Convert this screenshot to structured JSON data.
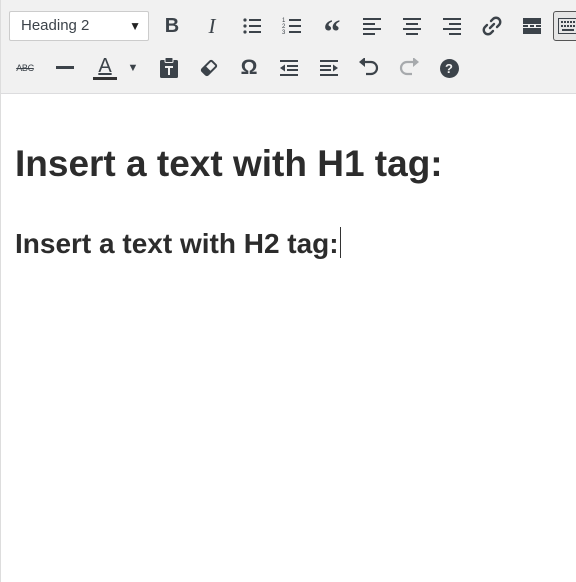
{
  "toolbar": {
    "format_select": {
      "value": "Heading 2"
    },
    "row1": [
      "bold-icon",
      "italic-icon",
      "bullet-list-icon",
      "numbered-list-icon",
      "blockquote-icon",
      "align-left-icon",
      "align-center-icon",
      "align-right-icon",
      "link-icon",
      "read-more-icon",
      "toolbar-toggle-icon"
    ],
    "row2": [
      "strikethrough-icon",
      "horizontal-line-icon",
      "text-color-icon",
      "text-color-dropdown-icon",
      "paste-as-text-icon",
      "clear-formatting-icon",
      "special-character-icon",
      "outdent-icon",
      "indent-icon",
      "undo-icon",
      "redo-icon",
      "help-icon"
    ],
    "text_color_glyph": "A",
    "strikethrough_glyph": "ABC",
    "special_char_glyph": "Ω",
    "help_glyph": "?"
  },
  "content": {
    "h1": "Insert a text with H1 tag:",
    "h2": "Insert a text with H2 tag:"
  }
}
